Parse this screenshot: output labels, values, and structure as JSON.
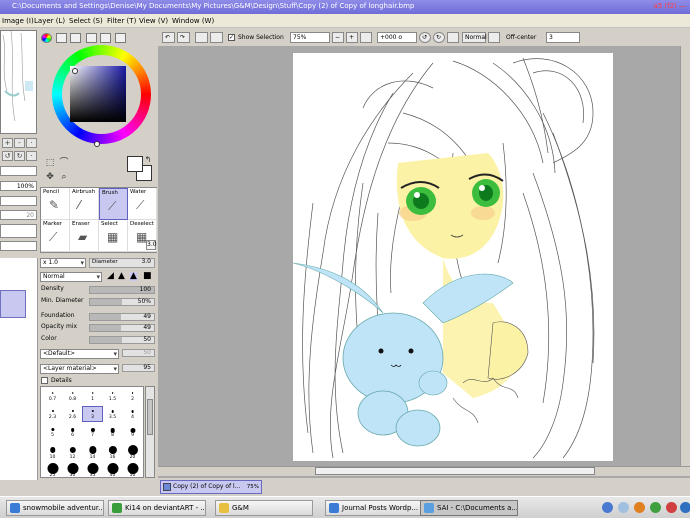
{
  "window": {
    "title": "C:\\Documents and Settings\\Denise\\My Documents\\My Pictures\\G&M\\Design\\Stuff\\Copy (2) of Copy of longhair.bmp",
    "title_right": "a5 (f2)  —"
  },
  "menu": [
    "Image (I)",
    "Layer (L)",
    "Select (S)",
    "Filter (T)",
    "View (V)",
    "Window (W)"
  ],
  "menu_underline": [
    "I",
    "L",
    "S",
    "T",
    "V",
    "W"
  ],
  "nav": {
    "percent": "100%",
    "angle": "20"
  },
  "tools": {
    "row1": [
      "Pencil",
      "Airbrush",
      "Brush",
      "Water"
    ],
    "row2": [
      "Marker",
      "Eraser",
      "Select",
      "Deselect"
    ],
    "selected": "Brush",
    "size_value": "3.0"
  },
  "brush": {
    "scale": "x 1.0",
    "diameter_label": "Diameter",
    "diameter_value": "3.0",
    "blend_mode": "Normal",
    "params": [
      {
        "label": "Density",
        "value": "100",
        "level": 1.0
      },
      {
        "label": "Min. Diameter",
        "value": "50%",
        "level": 0.5
      },
      {
        "label": "Foundation",
        "value": "49",
        "level": 0.49
      },
      {
        "label": "Opacity mix",
        "value": "49",
        "level": 0.49
      },
      {
        "label": "Color",
        "value": "50",
        "level": 0.5
      }
    ],
    "shape": "<Default>",
    "shape_value": "50",
    "texture": "<Layer material>",
    "texture_value": "95",
    "details_label": "Details",
    "sizes": [
      "0.7",
      "0.8",
      "1",
      "1.5",
      "2",
      "2.3",
      "2.6",
      "3",
      "3.5",
      "4",
      "5",
      "6",
      "7",
      "8",
      "9",
      "10",
      "12",
      "14",
      "16",
      "20",
      "25",
      "30",
      "35",
      "40",
      "50"
    ],
    "selected_size": "3"
  },
  "toolbar": {
    "show_selection": "Show Selection",
    "zoom": "75%",
    "rotation": "+000 o",
    "blend": "Normal",
    "offcenter_label": "Off-center",
    "offcenter_value": "3"
  },
  "doc_tab": {
    "name": "Copy (2) of Copy of l...",
    "zoom": "75%"
  },
  "taskbar": [
    {
      "label": "snowmobile adventur...",
      "icon_color": "#3a7bd5"
    },
    {
      "label": "Ki14 on deviantART - ...",
      "icon_color": "#3a9f3a"
    },
    {
      "label": "G&M",
      "icon_color": "#e8c040"
    },
    {
      "label": "Journal Posts Wordp...",
      "icon_color": "#3a7bd5"
    },
    {
      "label": "SAI - C:\\Documents a...",
      "icon_color": "#5aa0e0",
      "active": true
    }
  ],
  "colors": {
    "current": "#ffffff",
    "background": "#ffffff",
    "selection": "#c8c8f0"
  }
}
